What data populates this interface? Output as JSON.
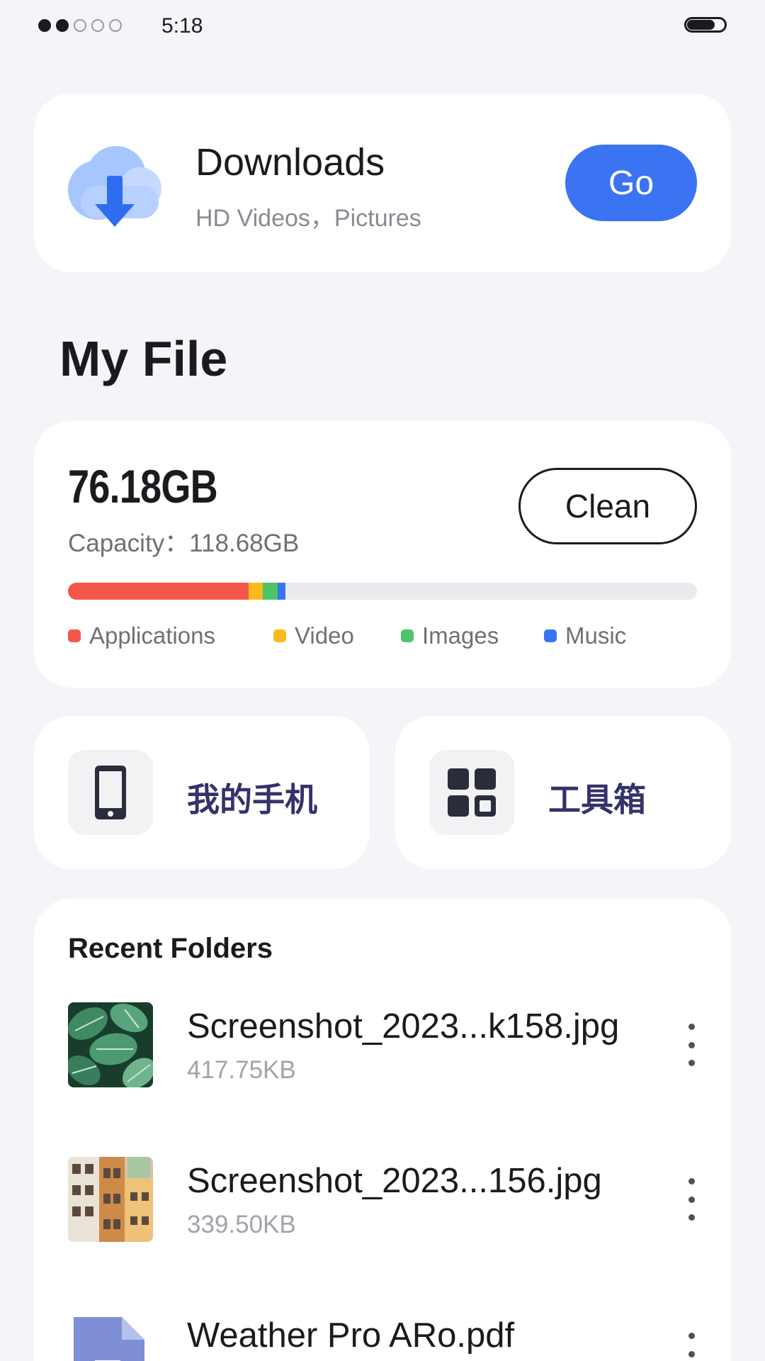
{
  "status_bar": {
    "time": "5:18",
    "signal_strength": 2,
    "signal_max": 5,
    "battery_level": 0.7
  },
  "download_card": {
    "icon": "cloud-download-icon",
    "title": "Downloads",
    "subtitle": "HD Videos，Pictures",
    "go_label": "Go",
    "accent_color": "#3a74f2"
  },
  "section_title": "My File",
  "storage": {
    "used": "76.18GB",
    "capacity": "Capacity：118.68GB",
    "clean_label": "Clean",
    "breakdown": [
      {
        "label": "Applications",
        "color": "#f5564a",
        "fraction": 0.287
      },
      {
        "label": "Video",
        "color": "#f8bb1b",
        "fraction": 0.023
      },
      {
        "label": "Images",
        "color": "#4cc46a",
        "fraction": 0.023
      },
      {
        "label": "Music",
        "color": "#3a74f2",
        "fraction": 0.013
      }
    ]
  },
  "quick_tiles": [
    {
      "icon": "phone-icon",
      "label": "我的手机"
    },
    {
      "icon": "toolbox-grid-icon",
      "label": "工具箱"
    }
  ],
  "recent": {
    "title": "Recent Folders",
    "files": [
      {
        "name": "Screenshot_2023...k158.jpg",
        "size": "417.75KB",
        "thumb": "leaves-photo"
      },
      {
        "name": "Screenshot_2023...156.jpg",
        "size": "339.50KB",
        "thumb": "buildings-photo"
      },
      {
        "name": "Weather Pro ARo.pdf",
        "size": "",
        "thumb": "document-icon"
      }
    ]
  }
}
